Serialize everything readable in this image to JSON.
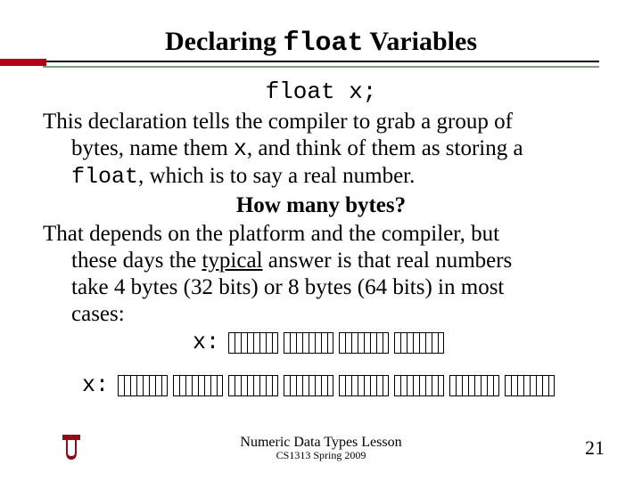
{
  "title": {
    "pre": "Declaring ",
    "code": "float",
    "post": " Variables"
  },
  "code_decl": "float x;",
  "para1": {
    "lead": "This declaration tells the compiler to grab a group of",
    "l2a": "bytes, name them ",
    "var": "x",
    "l2b": ", and think of them as storing a",
    "l3code": "float",
    "l3rest": ", which is to say a real number."
  },
  "subhead": "How many bytes?",
  "para2": {
    "lead": "That depends on the platform and the compiler, but",
    "l2a": "these days the ",
    "typical": "typical",
    "l2b": " answer is that real numbers",
    "l3": "take 4 bytes (32 bits) or 8 bytes (64 bits) in most",
    "l4": "cases:"
  },
  "bits_label": "x:",
  "footer": {
    "line1": "Numeric Data Types Lesson",
    "line2": "CS1313 Spring 2009"
  },
  "page_num": "21",
  "logo": {
    "name": "ou-logo",
    "fill": "#8a0f1a"
  }
}
